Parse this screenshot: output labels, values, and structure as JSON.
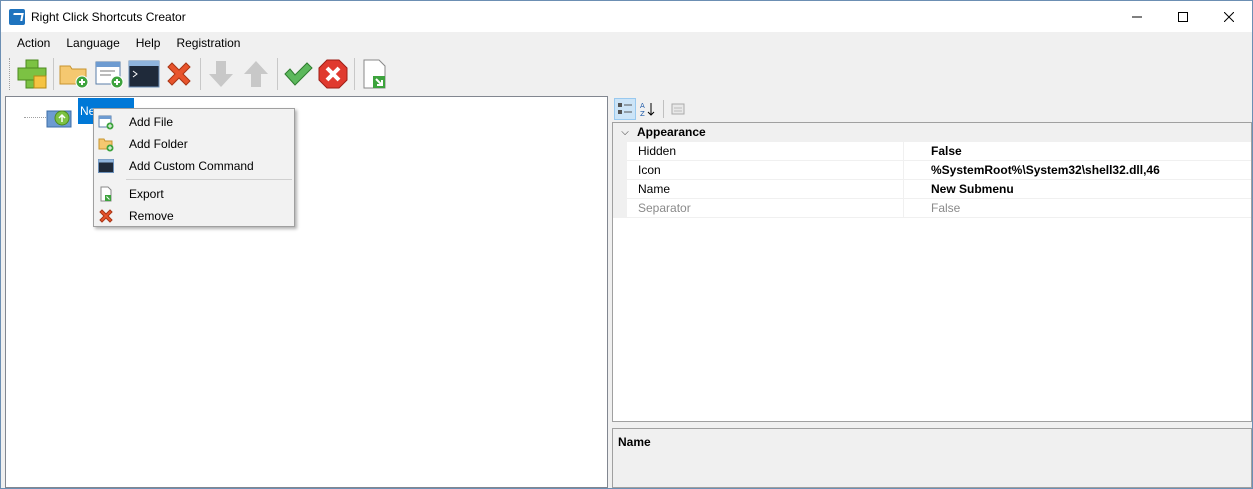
{
  "window": {
    "title": "Right Click Shortcuts Creator",
    "controls": {
      "minimize": "—",
      "maximize": "☐",
      "close": "✕"
    }
  },
  "menubar": {
    "items": [
      "Action",
      "Language",
      "Help",
      "Registration"
    ]
  },
  "toolbar": {
    "buttons": [
      "add-submenu",
      "add-folder",
      "add-file",
      "add-custom-command",
      "remove",
      "move-down",
      "move-up",
      "apply",
      "cancel",
      "export"
    ]
  },
  "tree": {
    "root_label": "Ne"
  },
  "context_menu": {
    "items": [
      {
        "label": "Add File",
        "icon": "add-file-icon"
      },
      {
        "label": "Add Folder",
        "icon": "add-folder-icon"
      },
      {
        "label": "Add Custom Command",
        "icon": "custom-command-icon"
      },
      {
        "label": "Export",
        "icon": "export-icon"
      },
      {
        "label": "Remove",
        "icon": "remove-icon"
      }
    ]
  },
  "property_grid": {
    "category": "Appearance",
    "rows": [
      {
        "name": "Hidden",
        "value": "False"
      },
      {
        "name": "Icon",
        "value": "%SystemRoot%\\System32\\shell32.dll,46"
      },
      {
        "name": "Name",
        "value": "New Submenu"
      },
      {
        "name": "Separator",
        "value": "False"
      }
    ],
    "description_title": "Name"
  },
  "colors": {
    "selection": "#0078d7",
    "remove_red": "#e8542c",
    "apply_green": "#3da33d"
  }
}
